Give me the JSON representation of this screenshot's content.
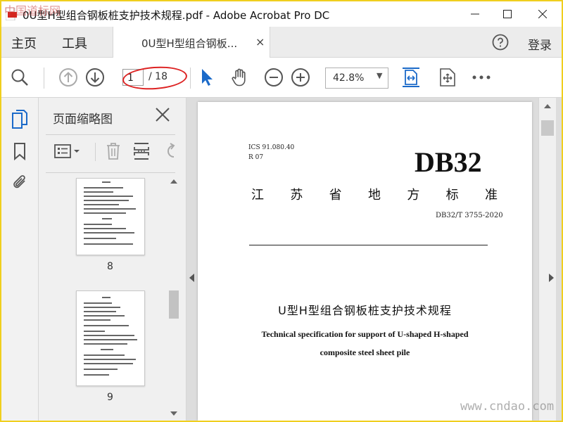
{
  "window": {
    "title": "0U型H型组合钢板桩支护技术规程.pdf - Adobe Acrobat Pro DC"
  },
  "menubar": {
    "home_label": "主页",
    "tools_label": "工具",
    "doc_tab_label": "0U型H型组合钢板...",
    "doc_tab_close": "×",
    "signin_label": "登录"
  },
  "toolbar": {
    "page_current": "1",
    "page_total": "/ 18",
    "zoom_value": "42.8%",
    "zoom_caret": "▼"
  },
  "thumbnails": {
    "title": "页面缩略图",
    "pages": [
      {
        "number": "8"
      },
      {
        "number": "9"
      }
    ]
  },
  "document": {
    "ics": "ICS 91.080.40",
    "classification": "R 07",
    "standard_prefix": "DB32",
    "province_chars": [
      "江",
      "苏",
      "省",
      "地",
      "方",
      "标",
      "准"
    ],
    "standard_code": "DB32/T 3755-2020",
    "title_cn": "U型H型组合钢板桩支护技术规程",
    "title_en_line1": "Technical specification for support of U-shaped H-shaped",
    "title_en_line2": "composite steel sheet pile"
  },
  "watermarks": {
    "top_left": "中国道标网",
    "bottom_right": "www.cndao.com"
  },
  "colors": {
    "accent_blue": "#1b6ac9",
    "annotation_red": "#dd2222",
    "app_red": "#d4261f",
    "frame_yellow": "#f0cf1e"
  }
}
